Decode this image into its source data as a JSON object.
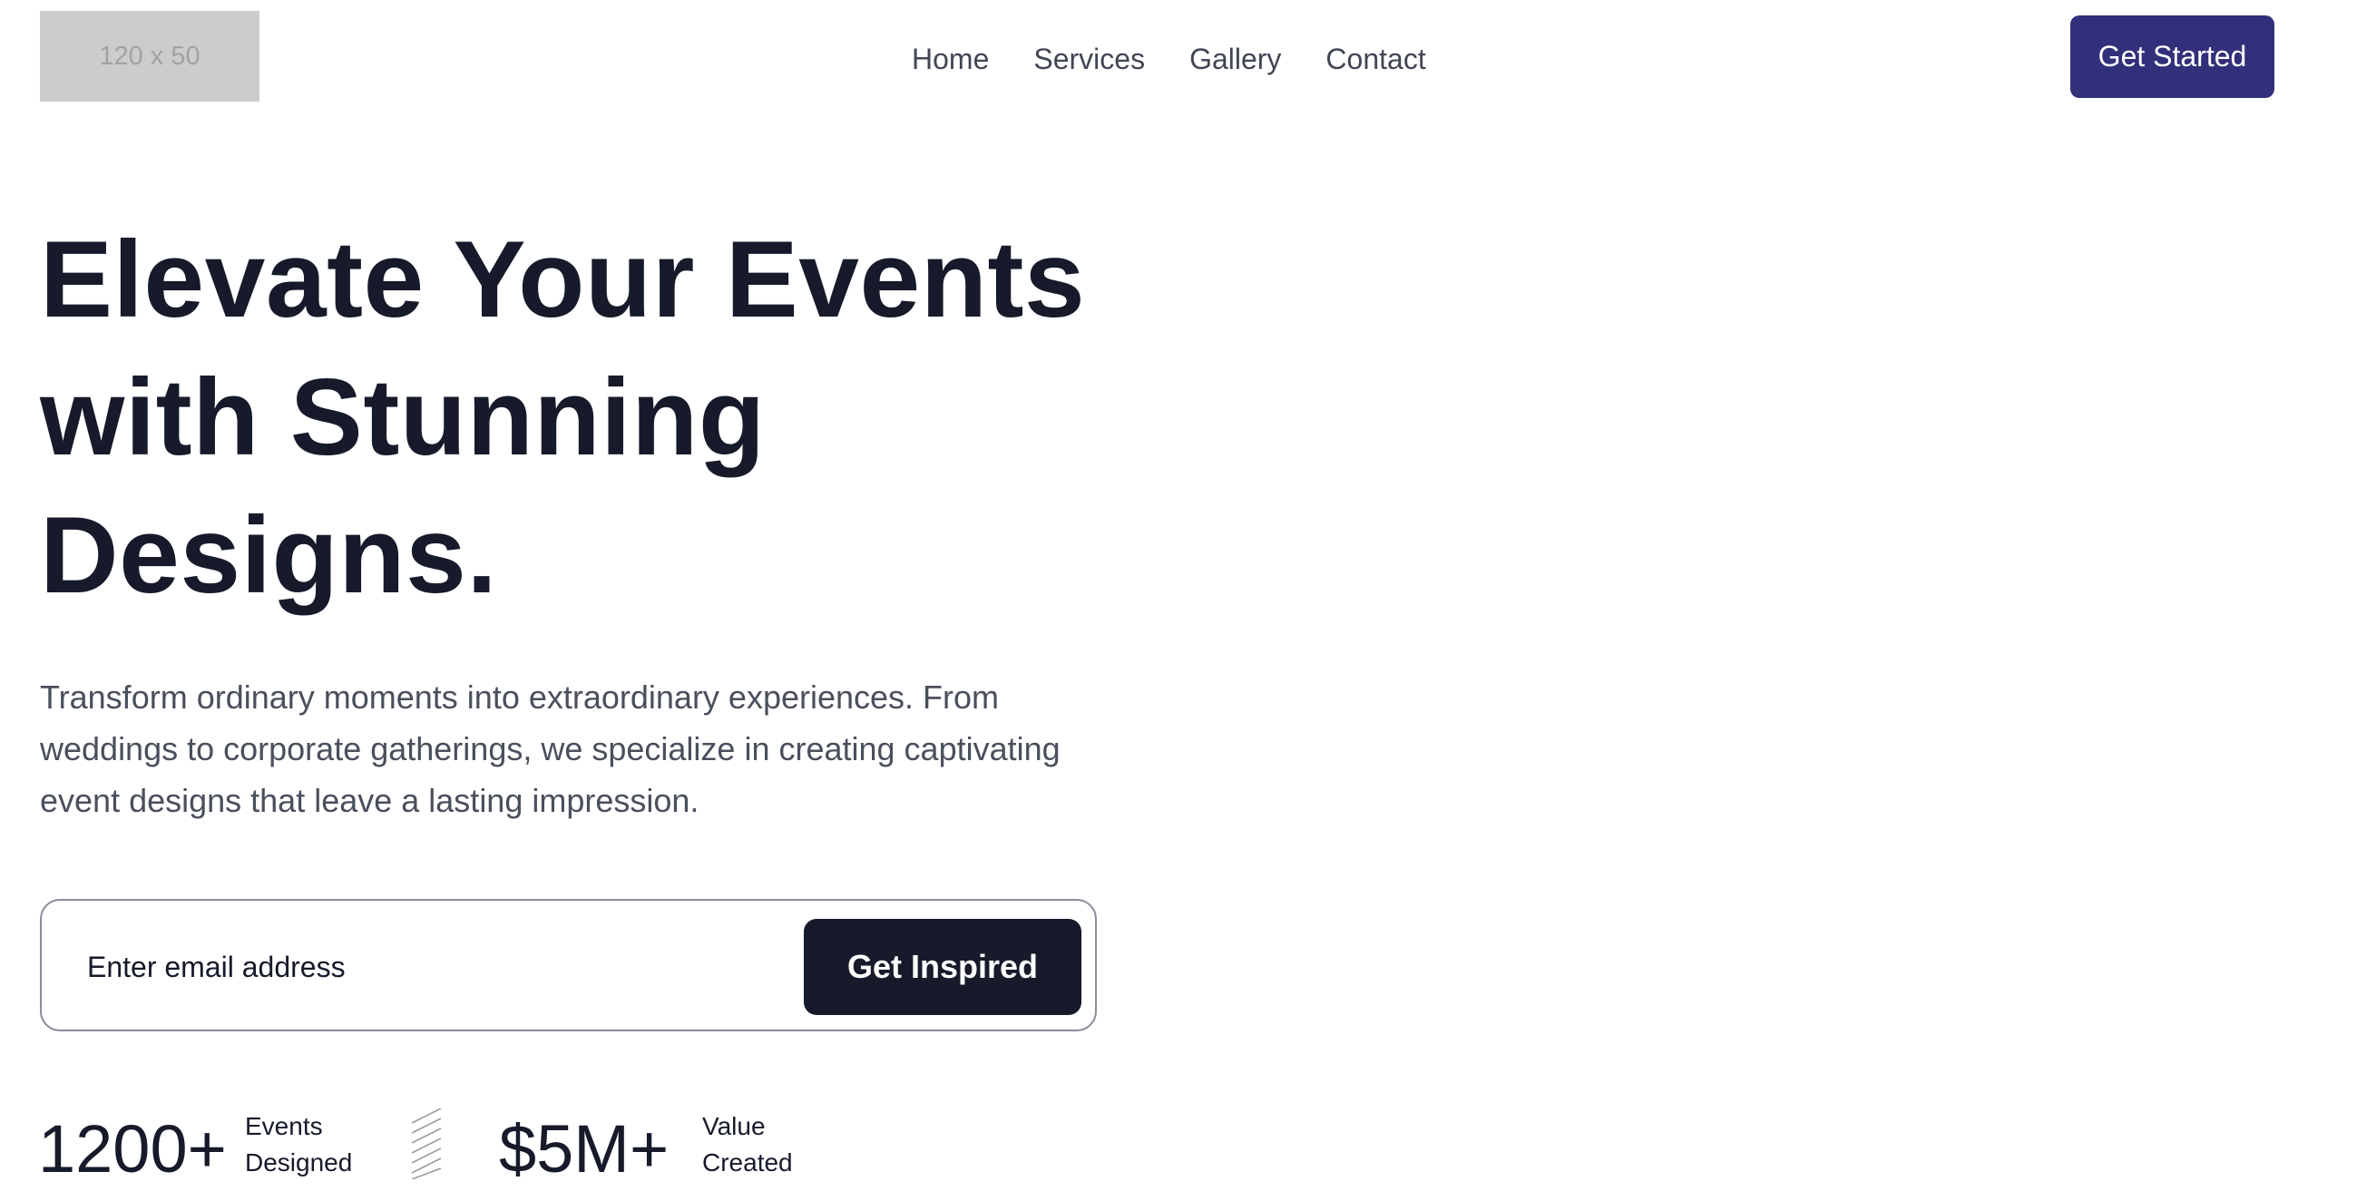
{
  "header": {
    "logo_text": "120 x 50",
    "nav": [
      "Home",
      "Services",
      "Gallery",
      "Contact"
    ],
    "cta_label": "Get Started"
  },
  "hero": {
    "title_lines": [
      "Elevate Your Events",
      "with Stunning",
      "Designs."
    ],
    "description": "Transform ordinary moments into extraordinary experiences. From weddings to corporate gatherings, we specialize in creating captivating event designs that leave a lasting impression."
  },
  "signup": {
    "email_placeholder": "Enter email address",
    "button_label": "Get Inspired"
  },
  "stats": [
    {
      "number": "1200+",
      "label_line1": "Events",
      "label_line2": "Designed"
    },
    {
      "number": "$5M+",
      "label_line1": "Value",
      "label_line2": "Created"
    }
  ],
  "colors": {
    "primary_button": "#32307a",
    "dark": "#161a2a",
    "body_text": "#4a4f5c",
    "logo_placeholder": "#cccccc"
  }
}
